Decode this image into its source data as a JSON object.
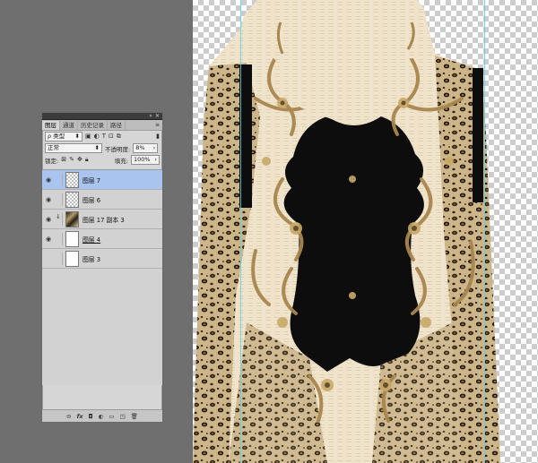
{
  "panel": {
    "tabs": [
      "图层",
      "通道",
      "历史记录",
      "路径"
    ],
    "menu_icon": "panel-menu-icon",
    "filter": {
      "label": "ρ 类型",
      "icons": [
        "image-filter-icon",
        "adjustment-filter-icon",
        "text-filter-icon",
        "shape-filter-icon",
        "smartobject-filter-icon"
      ]
    },
    "blend_mode": "正常",
    "opacity_label": "不透明度:",
    "opacity_value": "8%",
    "lock_label": "锁定:",
    "fill_label": "填充:",
    "fill_value": "100%",
    "layers": [
      {
        "name": "图层 7",
        "visible": true,
        "selected": true,
        "thumb": "checker"
      },
      {
        "name": "图层 6",
        "visible": true,
        "selected": false,
        "thumb": "checker"
      },
      {
        "name": "图层 17 副本 3",
        "visible": true,
        "selected": false,
        "thumb": "pattern",
        "clipped": true
      },
      {
        "name": "图层 4",
        "visible": true,
        "selected": false,
        "thumb": "white"
      },
      {
        "name": "图层 3",
        "visible": false,
        "selected": false,
        "thumb": "white"
      }
    ],
    "bottom_icons": [
      "link-icon",
      "fx-icon",
      "mask-icon",
      "adjustment-icon",
      "folder-icon",
      "new-layer-icon",
      "trash-icon"
    ],
    "bottom_labels": [
      "⊖",
      "fx",
      "◘",
      "◐",
      "▭",
      "◳",
      "🗑"
    ]
  },
  "colors": {
    "workspace": "#707070",
    "selected_layer": "#a9c4ef",
    "guide": "#5fd0e6",
    "dress_base": "#efe3cc",
    "dress_dark": "#0d0d0d",
    "ornament_gold": "#a8864e"
  }
}
